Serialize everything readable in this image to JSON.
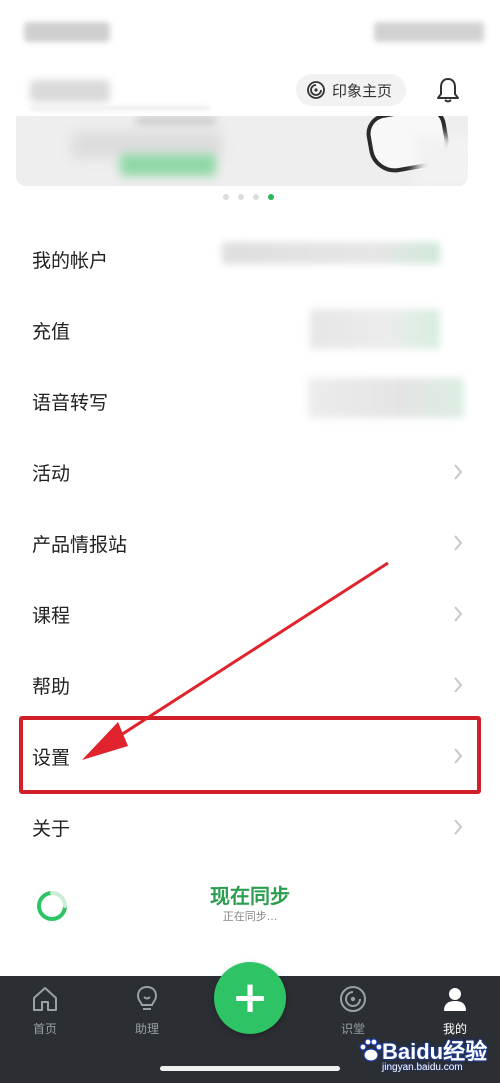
{
  "header": {
    "home_button_label": "印象主页"
  },
  "banner": {
    "carousel_count": 4,
    "active_index": 3
  },
  "menu": {
    "items": [
      {
        "label": "我的帐户",
        "has_value": true
      },
      {
        "label": "充值",
        "has_value": true
      },
      {
        "label": "语音转写",
        "has_value": true
      },
      {
        "label": "活动",
        "has_value": false
      },
      {
        "label": "产品情报站",
        "has_value": false
      },
      {
        "label": "课程",
        "has_value": false
      },
      {
        "label": "帮助",
        "has_value": false
      },
      {
        "label": "设置",
        "has_value": false
      },
      {
        "label": "关于",
        "has_value": false
      }
    ],
    "highlighted_item": "设置"
  },
  "sync": {
    "title": "现在同步",
    "subtitle": "正在同步..."
  },
  "tabbar": {
    "tabs": [
      {
        "label": "首页",
        "icon": "home-icon"
      },
      {
        "label": "助理",
        "icon": "lightbulb-icon"
      },
      {
        "label": "识堂",
        "icon": "compass-icon"
      },
      {
        "label": "我的",
        "icon": "person-icon"
      }
    ],
    "active_tab": "我的",
    "add_icon": "plus-icon"
  },
  "watermark": {
    "main": "Baidu经验",
    "sub": "jingyan.baidu.com"
  },
  "colors": {
    "accent_green": "#2ec465",
    "sync_green": "#2a9d4f",
    "highlight_red": "#d0202a",
    "tabbar_bg": "#2b2e33"
  }
}
